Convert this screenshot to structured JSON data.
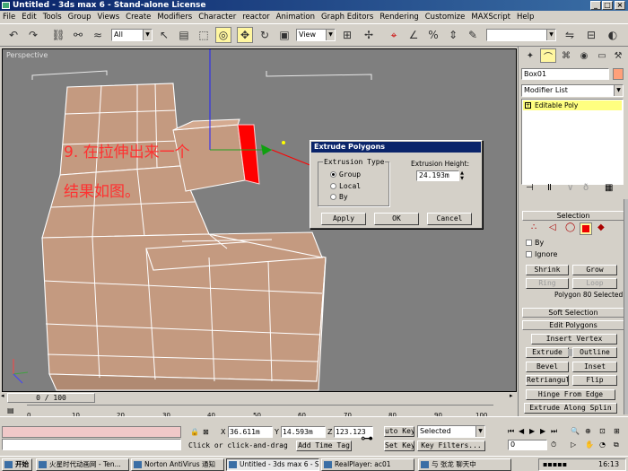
{
  "window": {
    "title": "Untitled - 3ds max 6 - Stand-alone License"
  },
  "menu": [
    "File",
    "Edit",
    "Tools",
    "Group",
    "Views",
    "Create",
    "Modifiers",
    "Character",
    "reactor",
    "Animation",
    "Graph Editors",
    "Rendering",
    "Customize",
    "MAXScript",
    "Help"
  ],
  "toolbar": {
    "selection_filter": "All",
    "ref_coord": "View"
  },
  "viewport": {
    "label": "Perspective",
    "annotation_line1": "9. 在拉伸出来一个",
    "annotation_line2": "结果如图。"
  },
  "dialog": {
    "title": "Extrude Polygons",
    "group_label": "Extrusion Type",
    "options": [
      "Group",
      "Local",
      "By"
    ],
    "selected_option": "Group",
    "height_label": "Extrusion Height:",
    "height_value": "24.193m",
    "apply": "Apply",
    "ok": "OK",
    "cancel": "Cancel"
  },
  "command_panel": {
    "object_name": "Box01",
    "modifier_list": "Modifier List",
    "stack_item": "Editable Poly",
    "selection_header": "Selection",
    "by_label": "By",
    "ignore_label": "Ignore",
    "shrink": "Shrink",
    "grow": "Grow",
    "ring": "Ring",
    "loop": "Loop",
    "selection_status": "Polygon 80 Selected",
    "soft_selection": "Soft Selection",
    "edit_polygons": "Edit Polygons",
    "insert_vertex": "Insert Vertex",
    "extrude": "Extrude",
    "outline": "Outline",
    "bevel": "Bevel",
    "inset": "Inset",
    "retriangulate": "Retriangula",
    "flip": "Flip",
    "hinge_from_edge": "Hinge From Edge",
    "extrude_along_spline": "Extrude Along Splin"
  },
  "timeline": {
    "frame": "0 / 100",
    "ticks": [
      "0",
      "10",
      "20",
      "30",
      "40",
      "50",
      "60",
      "70",
      "80",
      "90",
      "100"
    ]
  },
  "status": {
    "x_label": "X",
    "x": "36.611m",
    "y_label": "Y",
    "y": "14.593m",
    "z_label": "Z",
    "z": "123.123",
    "prompt": "Click or click-and-drag",
    "add_time_tag": "Add Time Tag",
    "auto_key": "uto Key",
    "set_key": "Set Key",
    "key_mode": "Selected",
    "key_filters": "Key Filters...",
    "frame_value": "0"
  },
  "taskbar": {
    "start": "开始",
    "tasks": [
      "火星时代动画网 - Ten...",
      "Norton AntiVirus 通知",
      "Untitled - 3ds max 6 - S...",
      "RealPlayer: ac01",
      "与 张龙 聊天中"
    ],
    "clock": "16:13"
  },
  "colors": {
    "selection_red": "#ff0000",
    "vertex_yellow": "#ffff00",
    "viewport_bg": "#7f7f7f",
    "mesh_fill": "#c49a80",
    "stack_highlight": "#ffff80",
    "object_color": "#ffa07a"
  }
}
